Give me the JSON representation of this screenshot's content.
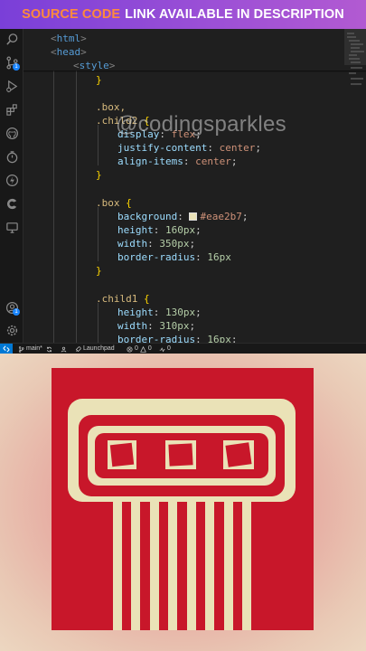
{
  "banner": {
    "highlight": "SOURCE CODE",
    "rest": "LINK AVAILABLE IN DESCRIPTION"
  },
  "watermark": "@codingsparkles",
  "code_lines": [
    {
      "t": "<html>"
    },
    {
      "t": "<head>"
    },
    {
      "t": "<style>"
    },
    {
      "t": "}"
    },
    {
      "t": ".box,"
    },
    {
      "t": ".child2 {"
    },
    {
      "t": "display: flex;"
    },
    {
      "t": "justify-content: center;"
    },
    {
      "t": "align-items: center;"
    },
    {
      "t": "}"
    },
    {
      "t": ".box {"
    },
    {
      "t": "background: #eae2b7;"
    },
    {
      "t": "height: 160px;"
    },
    {
      "t": "width: 350px;"
    },
    {
      "t": "border-radius: 16px"
    },
    {
      "t": "}"
    },
    {
      "t": ".child1 {"
    },
    {
      "t": "height: 130px;"
    },
    {
      "t": "width: 310px;"
    },
    {
      "t": "border-radius: 16px;"
    }
  ],
  "code": {
    "html_tag": "html",
    "head_tag": "head",
    "style_tag": "style",
    "sel_box_comma": ".box,",
    "sel_child2": ".child2",
    "p_display": "display",
    "v_flex": "flex",
    "p_justify": "justify-content",
    "v_center": "center",
    "p_align": "align-items",
    "sel_box": ".box",
    "p_background": "background",
    "v_bg": "#eae2b7",
    "p_height": "height",
    "v_160": "160px",
    "p_width": "width",
    "v_350": "350px",
    "p_radius": "border-radius",
    "v_16": "16px",
    "sel_child1": ".child1",
    "v_130": "130px",
    "v_310": "310px"
  },
  "status": {
    "branch": "main*",
    "launchpad": "Launchpad",
    "errors": "0",
    "warnings": "0",
    "ports": "0"
  },
  "activity_icons": [
    "search-icon",
    "source-control-icon",
    "run-debug-icon",
    "extensions-icon",
    "github-icon",
    "timer-icon",
    "lightning-icon",
    "copilot-icon",
    "remote-explorer-icon",
    "account-icon",
    "settings-icon"
  ],
  "colors": {
    "accent": "#0078d4",
    "box_red": "#c8172a",
    "cream": "#eae2b7",
    "banner_orange": "#ff8a3d"
  }
}
